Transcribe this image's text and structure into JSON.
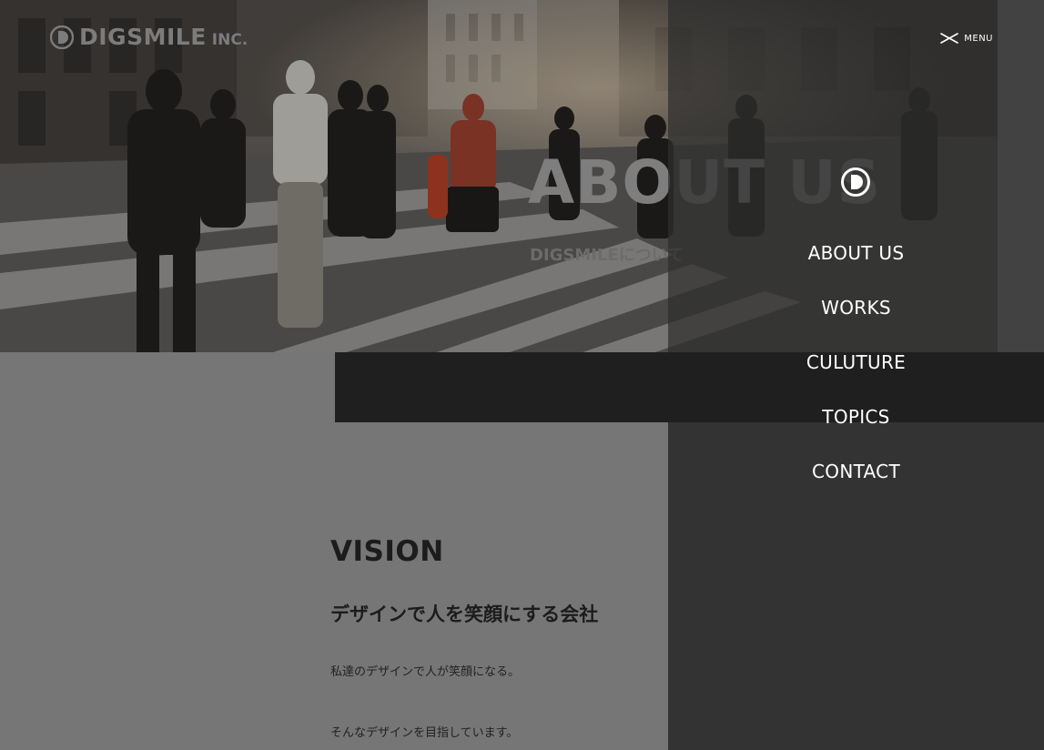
{
  "brand": {
    "name": "DIGSMILE",
    "suffix": "INC."
  },
  "hero": {
    "title": "ABOUT US",
    "subtitle": "DIGSMILEについて"
  },
  "vision": {
    "heading": "VISION",
    "lead": "デザインで人を笑顔にする会社",
    "paragraphs": [
      "私達のデザインで人が笑顔になる。",
      "そんなデザインを目指しています。"
    ]
  },
  "menu": {
    "toggle_label": "MENU",
    "items": [
      {
        "label": "ABOUT US"
      },
      {
        "label": "WORKS"
      },
      {
        "label": "CULUTURE"
      },
      {
        "label": "TOPICS"
      },
      {
        "label": "CONTACT"
      }
    ]
  },
  "colors": {
    "page_background": "#767676",
    "dark_band": "#1f1f1f",
    "menu_panel": "#333333",
    "menu_text": "#ffffff",
    "heading_text": "#1c1c1c"
  },
  "icons": {
    "brand_logo": "digsmile-d-logo-icon",
    "menu_close": "close-x-icon",
    "menu_logo": "digsmile-d-logo-icon"
  }
}
